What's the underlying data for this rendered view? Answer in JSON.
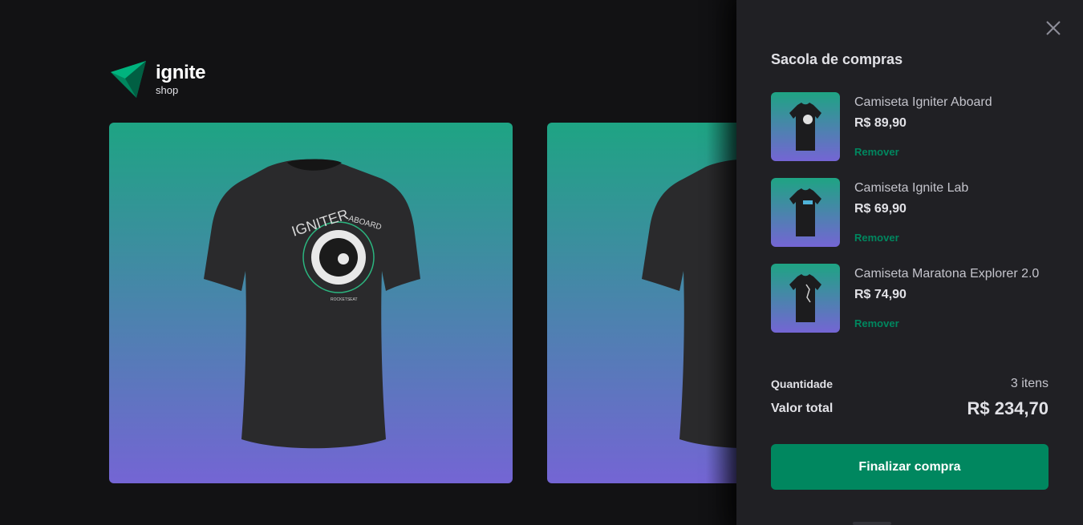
{
  "logo": {
    "title": "ignite",
    "subtitle": "shop"
  },
  "products": [
    {
      "print_text_top": "IGNITER",
      "print_text_side": "ABOARD",
      "brand": "ROCKETSEAT"
    },
    {}
  ],
  "cart": {
    "title": "Sacola de compras",
    "close_icon": "close-icon",
    "items": [
      {
        "name": "Camiseta Igniter Aboard",
        "price": "R$ 89,90",
        "remove_label": "Remover"
      },
      {
        "name": "Camiseta Ignite Lab",
        "price": "R$ 69,90",
        "remove_label": "Remover"
      },
      {
        "name": "Camiseta Maratona Explorer 2.0",
        "price": "R$ 74,90",
        "remove_label": "Remover"
      }
    ],
    "quantity_label": "Quantidade",
    "quantity_value": "3 itens",
    "total_label": "Valor total",
    "total_value": "R$ 234,70",
    "checkout_label": "Finalizar compra"
  },
  "colors": {
    "background": "#121214",
    "drawer": "#202024",
    "accent": "#00875f",
    "gradient_top": "#1ea483",
    "gradient_bottom": "#7465d4"
  }
}
